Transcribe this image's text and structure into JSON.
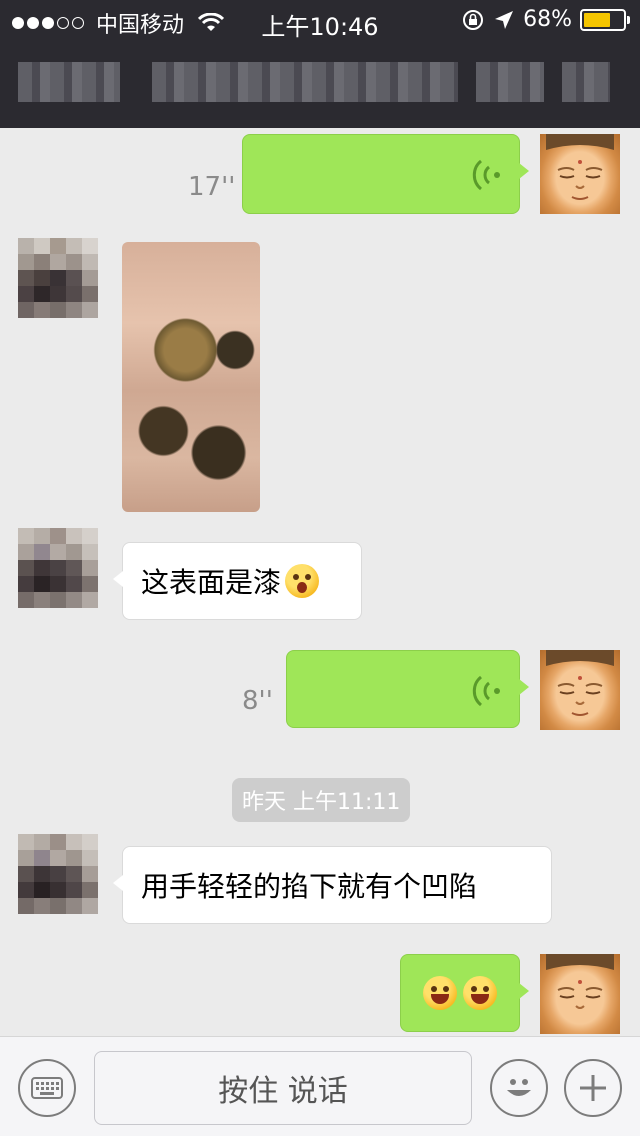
{
  "status_bar": {
    "carrier": "中国移动",
    "time": "上午10:46",
    "battery": "68%",
    "battery_level": 0.68,
    "signal_bars_filled": 3,
    "signal_bars_total": 5
  },
  "messages": {
    "m1": {
      "duration": "17''"
    },
    "m3": {
      "text": "这表面是漆"
    },
    "m4": {
      "duration": "8''"
    },
    "timestamp": "昨天 上午11:11",
    "m5": {
      "text": "用手轻轻的掐下就有个凹陷"
    }
  },
  "input_bar": {
    "hold_to_talk": "按住 说话"
  },
  "colors": {
    "accent_green": "#9fe658",
    "nav_bg": "#2b2a30",
    "chat_bg": "#ebebeb"
  }
}
